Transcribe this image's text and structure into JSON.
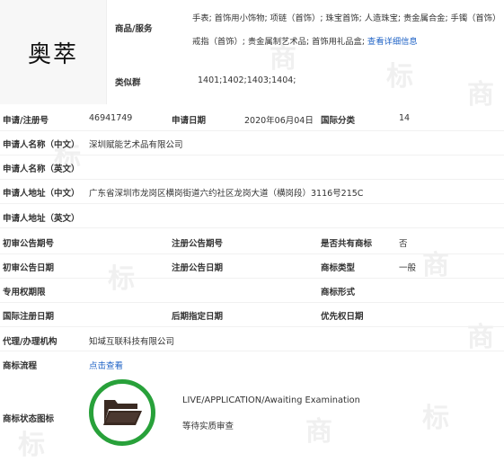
{
  "logo": {
    "text": "奥萃"
  },
  "goods": {
    "label": "商品/服务",
    "line1": "手表; 首饰用小饰物; 项链（首饰）; 珠宝首饰; 人造珠宝; 贵金属合金; 手镯（首饰）",
    "line2": "戒指（首饰）; 贵金属制艺术品; 首饰用礼品盒;",
    "more_link": "查看详细信息"
  },
  "similar": {
    "label": "类似群",
    "value": "1401;1402;1403;1404;"
  },
  "reg": {
    "no_label": "申请/注册号",
    "no_value": "46941749",
    "date_label": "申请日期",
    "date_value": "2020年06月04日",
    "class_label": "国际分类",
    "class_value": "14"
  },
  "applicant_cn": {
    "label": "申请人名称（中文）",
    "value": "深圳赋能艺术品有限公司"
  },
  "applicant_en": {
    "label": "申请人名称（英文）",
    "value": ""
  },
  "address_cn": {
    "label": "申请人地址（中文）",
    "value": "广东省深圳市龙岗区横岗街道六约社区龙岗大道（横岗段）3116号215C"
  },
  "address_en": {
    "label": "申请人地址（英文）",
    "value": ""
  },
  "notice": {
    "prelim_no_label": "初审公告期号",
    "reg_no_label": "注册公告期号",
    "shared_label": "是否共有商标",
    "shared_value": "否",
    "prelim_date_label": "初审公告日期",
    "reg_date_label": "注册公告日期",
    "type_label": "商标类型",
    "type_value": "一般",
    "exclusive_label": "专用权期限",
    "form_label": "商标形式",
    "intl_date_label": "国际注册日期",
    "later_date_label": "后期指定日期",
    "priority_label": "优先权日期"
  },
  "agent": {
    "label": "代理/办理机构",
    "value": "知域互联科技有限公司"
  },
  "process": {
    "label": "商标流程",
    "link": "点击查看"
  },
  "status": {
    "label": "商标状态图标",
    "line1": "LIVE/APPLICATION/Awaiting Examination",
    "line2": "等待实质审查",
    "icon": "folder-icon",
    "color": "#28a13a"
  },
  "watermarks": [
    "商",
    "标",
    "商",
    "标",
    "商",
    "标",
    "商",
    "标",
    "商",
    "标"
  ]
}
